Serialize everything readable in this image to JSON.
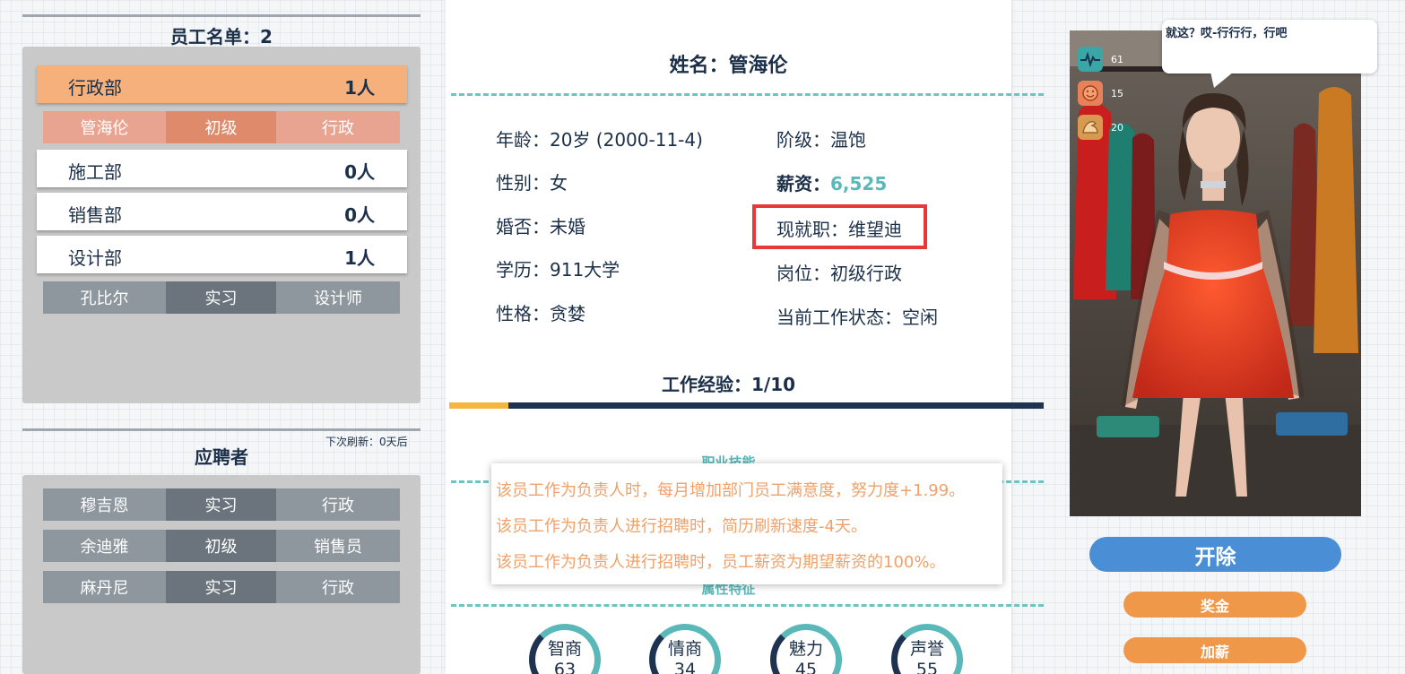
{
  "staff_list": {
    "title": "员工名单：2",
    "departments": [
      {
        "name": "行政部",
        "count": "1人"
      },
      {
        "name": "施工部",
        "count": "0人"
      },
      {
        "name": "销售部",
        "count": "0人"
      },
      {
        "name": "设计部",
        "count": "1人"
      }
    ],
    "admin_employee": {
      "name": "管海伦",
      "level": "初级",
      "role": "行政"
    },
    "design_employee": {
      "name": "孔比尔",
      "level": "实习",
      "role": "设计师"
    }
  },
  "applicants": {
    "title": "应聘者",
    "refresh_note": "下次刷新：0天后",
    "rows": [
      {
        "name": "穆吉恩",
        "level": "实习",
        "role": "行政"
      },
      {
        "name": "余迪雅",
        "level": "初级",
        "role": "销售员"
      },
      {
        "name": "麻丹尼",
        "level": "实习",
        "role": "行政"
      }
    ]
  },
  "profile": {
    "name_line": "姓名：管海伦",
    "age": "年龄：20岁 (2000-11-4)",
    "gender": "性别：女",
    "marital": "婚否：未婚",
    "education": "学历：911大学",
    "personality": "性格：贪婪",
    "class": "阶级：温饱",
    "salary_label": "薪资：",
    "salary_value": "6,525",
    "current_job": "现就职：维望迪",
    "position": "岗位：初级行政",
    "work_status": "当前工作状态：空闲",
    "experience_label": "工作经验：1/10",
    "experience_progress": 0.1,
    "skills_title": "职业技能",
    "traits_title": "属性特征"
  },
  "tooltip": {
    "lines": [
      "该员工作为负责人时，每月增加部门员工满意度，努力度+1.99。",
      "该员工作为负责人进行招聘时，简历刷新速度-4天。",
      "该员工作为负责人进行招聘时，员工薪资为期望薪资的100%。"
    ]
  },
  "attributes": [
    {
      "label": "智商",
      "value": "63"
    },
    {
      "label": "情商",
      "value": "34"
    },
    {
      "label": "魅力",
      "value": "45"
    },
    {
      "label": "声誉",
      "value": "55"
    }
  ],
  "portrait_stats": [
    {
      "icon": "heartbeat-icon",
      "value": "61",
      "color": "#3aa6a6"
    },
    {
      "icon": "smile-icon",
      "value": "15",
      "color": "#e8805a"
    },
    {
      "icon": "muscle-icon",
      "value": "20",
      "color": "#d89a50"
    }
  ],
  "speech": "就这？哎-行行行，行吧",
  "buttons": {
    "fire": "开除",
    "bonus": "奖金",
    "raise": "加薪"
  }
}
